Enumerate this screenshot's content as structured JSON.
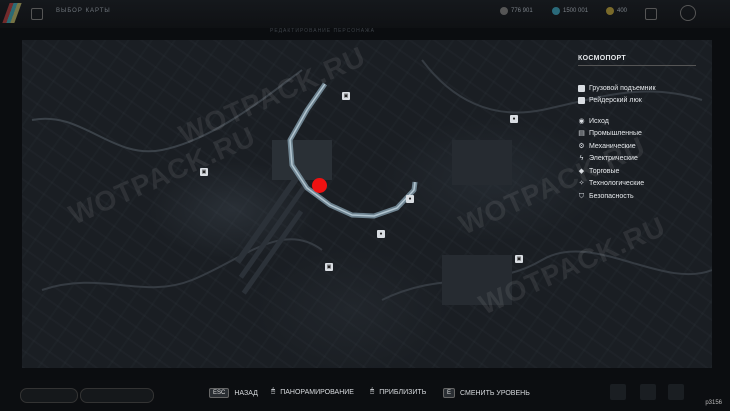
{
  "header": {
    "title": "ВЫБОР КАРТЫ",
    "subtitle": "РЕДАКТИРОВАНИЕ ПЕРСОНАЖА",
    "currencies": [
      "776 901",
      "1500 001",
      "400"
    ]
  },
  "map": {
    "watermarks": [
      "WOTPACK.RU",
      "WOTPACK.RU",
      "WOTPACK.RU",
      "WOTPACK.RU"
    ]
  },
  "legend": {
    "title": "КОСМОПОРТ",
    "group1": [
      {
        "label": "Грузовой подъемник",
        "icon": "elevator-icon"
      },
      {
        "label": "Рейдерский люк",
        "icon": "hatch-icon"
      }
    ],
    "group2": [
      {
        "label": "Исход",
        "icon": "eye-icon"
      },
      {
        "label": "Промышленные",
        "icon": "industrial-icon"
      },
      {
        "label": "Механические",
        "icon": "gear-icon"
      },
      {
        "label": "Электрические",
        "icon": "bolt-icon"
      },
      {
        "label": "Торговые",
        "icon": "trade-icon"
      },
      {
        "label": "Технологические",
        "icon": "tech-icon"
      },
      {
        "label": "Безопасность",
        "icon": "shield-icon"
      }
    ]
  },
  "footer": {
    "hints": [
      {
        "key": "ESC",
        "label": "НАЗАД"
      },
      {
        "key": "🖱",
        "label": "ПАНОРАМИРОВАНИЕ"
      },
      {
        "key": "🖱",
        "label": "ПРИБЛИЗИТЬ"
      },
      {
        "key": "E",
        "label": "СМЕНИТЬ УРОВЕНЬ"
      }
    ],
    "id_text": "p3156"
  }
}
